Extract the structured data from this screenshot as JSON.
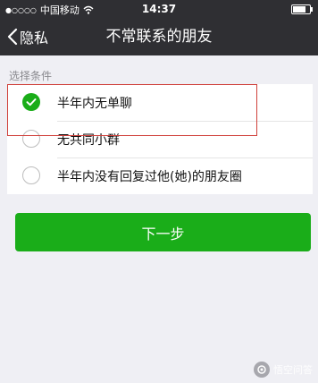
{
  "status_bar": {
    "carrier": "中国移动",
    "time": "14:37",
    "signal_icon": "signal-dots-icon",
    "wifi_icon": "wifi-icon",
    "battery_level": 0.85
  },
  "nav": {
    "back_label": "隐私",
    "back_icon": "chevron-left-icon",
    "title": "不常联系的朋友"
  },
  "section_label": "选择条件",
  "options": [
    {
      "label": "半年内无单聊",
      "checked": true
    },
    {
      "label": "无共同小群",
      "checked": false
    },
    {
      "label": "半年内没有回复过他(她)的朋友圈",
      "checked": false
    }
  ],
  "next_button": "下一步",
  "watermark": "悟空问答",
  "colors": {
    "bar": "#2f2f33",
    "accent_green": "#1aad19",
    "highlight_red": "#d0413b",
    "background": "#efeff4"
  }
}
